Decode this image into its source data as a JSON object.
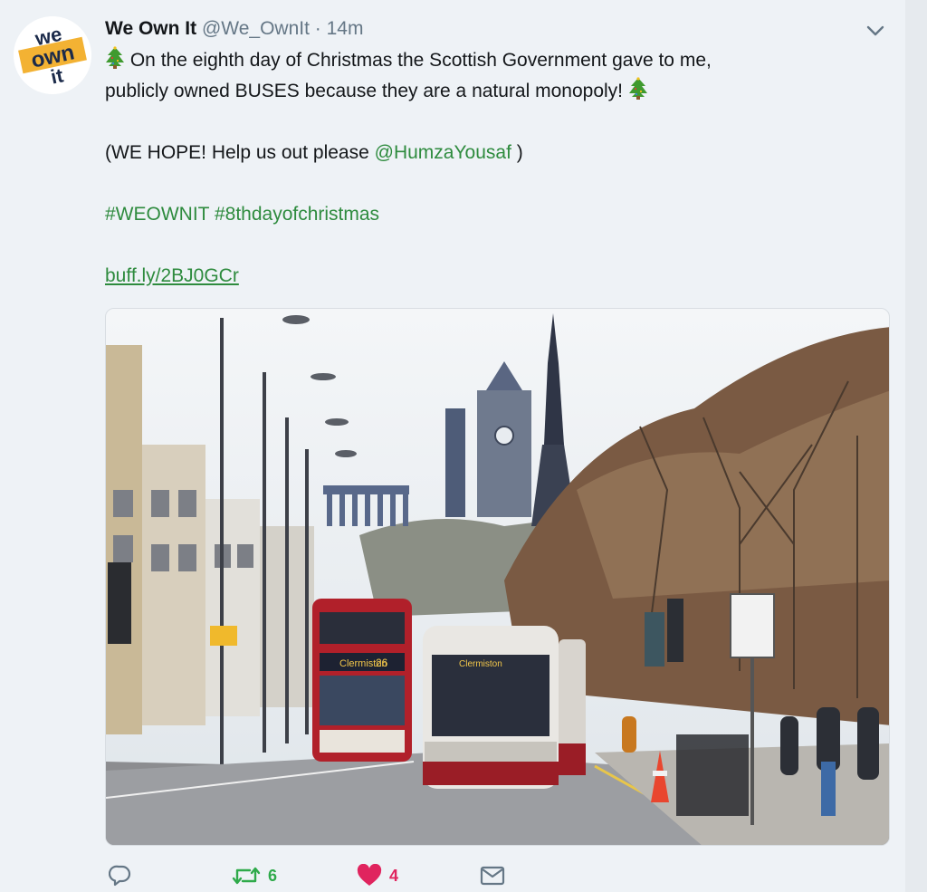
{
  "tweet": {
    "author_name": "We Own It",
    "handle": "@We_OwnIt",
    "separator": "·",
    "time": "14m",
    "avatar_text": [
      "we",
      "own",
      "it"
    ],
    "text": {
      "line1": "On the eighth day of Christmas the Scottish Government gave to me,",
      "line2": "publicly owned BUSES because they are a natural monopoly!",
      "line3_prefix": "(WE HOPE! Help us out please ",
      "mention": "@HumzaYousaf",
      "line3_suffix": " )",
      "hashtag1": "#WEOWNIT",
      "hashtag2": "#8thdayofchristmas",
      "link": "buff.ly/2BJ0GCr"
    },
    "emoji": "christmas-tree",
    "photo": {
      "bus_left_display": "Clermiston",
      "bus_left_route": "26",
      "bus_right_display": "Clermiston"
    }
  },
  "actions": {
    "reply_count": "",
    "retweet_count": "6",
    "like_count": "4"
  },
  "colors": {
    "accent_green": "#2e8b3e",
    "retweet_green": "#2eaa4a",
    "like_red": "#e0245e",
    "muted": "#657786",
    "background": "#eef2f6"
  }
}
